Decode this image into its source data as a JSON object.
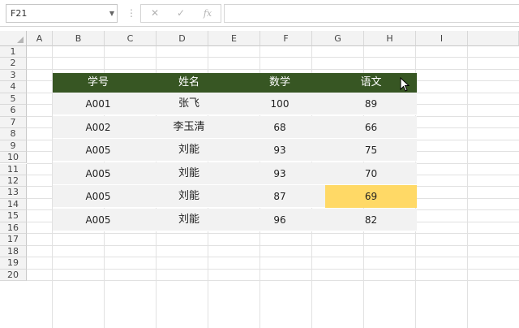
{
  "formula_bar": {
    "name_box": "F21",
    "dots": "⋮",
    "cancel": "✕",
    "enter": "✓",
    "function": "fx",
    "formula": ""
  },
  "columns": [
    "A",
    "B",
    "C",
    "D",
    "E",
    "F",
    "G",
    "H",
    "I"
  ],
  "rows": [
    "1",
    "2",
    "3",
    "4",
    "5",
    "6",
    "7",
    "8",
    "9",
    "10",
    "11",
    "12",
    "13",
    "14",
    "15",
    "16",
    "17",
    "18",
    "19",
    "20"
  ],
  "table": {
    "headers": [
      "学号",
      "姓名",
      "数学",
      "语文"
    ],
    "rows": [
      [
        "A001",
        "张飞",
        "100",
        "89"
      ],
      [
        "A002",
        "李玉清",
        "68",
        "66"
      ],
      [
        "A005",
        "刘能",
        "93",
        "75"
      ],
      [
        "A005",
        "刘能",
        "93",
        "70"
      ],
      [
        "A005",
        "刘能",
        "87",
        "69"
      ],
      [
        "A005",
        "刘能",
        "96",
        "82"
      ]
    ],
    "highlight_color": "#ffd966",
    "header_color": "#375623"
  }
}
